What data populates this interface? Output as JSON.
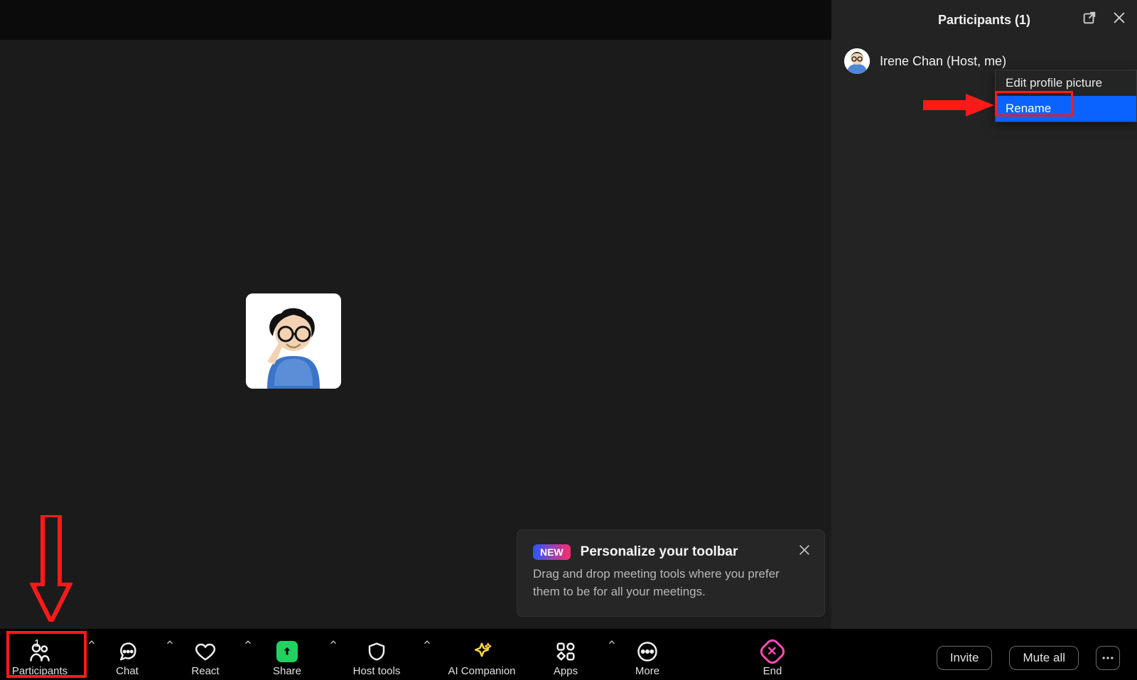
{
  "panel": {
    "title": "Participants (1)",
    "participant": {
      "name": "Irene Chan (Host, me)"
    }
  },
  "context_menu": {
    "edit_profile": "Edit profile picture",
    "rename": "Rename"
  },
  "toast": {
    "badge": "NEW",
    "title": "Personalize your toolbar",
    "body": "Drag and drop meeting tools where you prefer them to be for all your meetings."
  },
  "toolbar": {
    "participants": {
      "label": "Participants",
      "count": "1"
    },
    "chat": "Chat",
    "react": "React",
    "share": "Share",
    "host_tools": "Host tools",
    "ai_companion": "AI Companion",
    "apps": "Apps",
    "more": "More",
    "end": "End"
  },
  "panel_footer": {
    "invite": "Invite",
    "mute_all": "Mute all"
  }
}
